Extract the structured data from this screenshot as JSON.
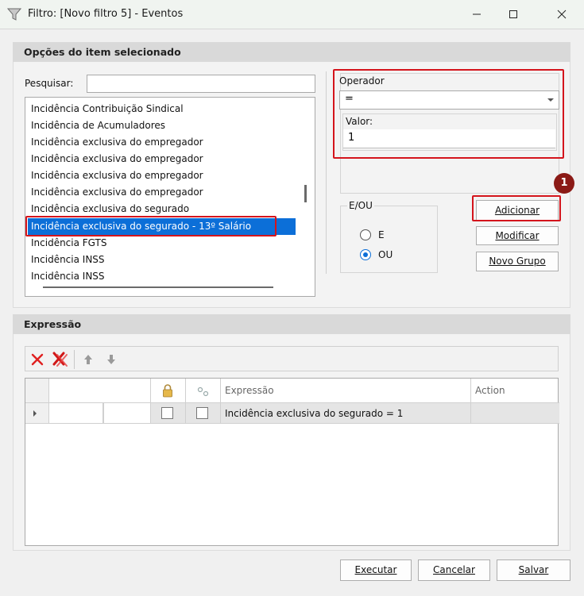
{
  "window": {
    "title": "Filtro: [Novo filtro 5] - Eventos"
  },
  "options_panel": {
    "header": "Opções do item selecionado",
    "search_label": "Pesquisar:",
    "search_value": "",
    "list_items": [
      "Incidência Contribuição Sindical",
      "Incidência de Acumuladores",
      "Incidência exclusiva do empregador",
      "Incidência exclusiva do empregador",
      "Incidência exclusiva do empregador",
      "Incidência exclusiva do empregador",
      "Incidência exclusiva do segurado",
      "Incidência exclusiva do segurado - 13º Salário",
      "Incidência FGTS",
      "Incidência INSS",
      "Incidência INSS"
    ],
    "selected_index": 7,
    "operator_label": "Operador",
    "operator_value": "=",
    "value_label": "Valor:",
    "value_value": "1",
    "eou_label": "E/OU",
    "radio_e": "E",
    "radio_ou": "OU",
    "radio_selected": "OU",
    "btn_add": "Adicionar",
    "btn_modify": "Modificar",
    "btn_new_group": "Novo Grupo",
    "step_badge": "1"
  },
  "expression_panel": {
    "header": "Expressão",
    "columns": {
      "expression": "Expressão",
      "action": "Action"
    },
    "rows": [
      {
        "expression": "Incidência exclusiva do segurado = 1",
        "action": ""
      }
    ]
  },
  "footer": {
    "execute": "Executar",
    "cancel": "Cancelar",
    "save": "Salvar"
  },
  "colors": {
    "selection": "#0c6fd8",
    "highlight_outline": "#d4141c",
    "badge": "#8b1a16"
  }
}
